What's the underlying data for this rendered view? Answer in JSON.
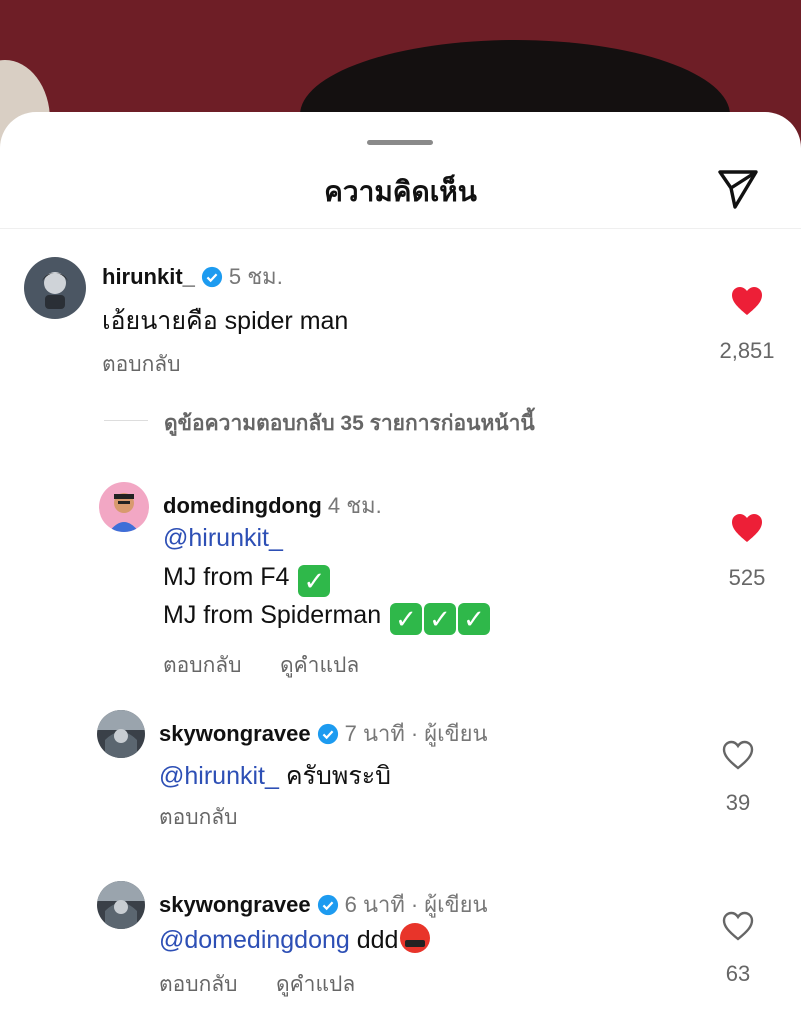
{
  "sheet": {
    "title": "ความคิดเห็น"
  },
  "colors": {
    "mention": "#2d4fb5",
    "heart_filled": "#ed1f37",
    "verified": "#1d9bf0",
    "photo_bg": "#6e1e26"
  },
  "comments": [
    {
      "username": "hirunkit_",
      "verified": true,
      "time": "5 ชม.",
      "text": "เอ้ยนายคือ spider man",
      "reply_label": "ตอบกลับ",
      "likes": "2,851",
      "liked": true,
      "view_replies": "ดูข้อความตอบกลับ 35 รายการก่อนหน้านี้"
    },
    {
      "username": "domedingdong",
      "verified": false,
      "time": "4 ชม.",
      "mention": "@hirunkit_",
      "line1": "MJ from F4",
      "line2": "MJ from Spiderman",
      "reply_label": "ตอบกลับ",
      "translate_label": "ดูคำแปล",
      "likes": "525",
      "liked": true
    },
    {
      "username": "skywongravee",
      "verified": true,
      "time": "7 นาที",
      "author_tag": "ผู้เขียน",
      "mention": "@hirunkit_",
      "text": "ครับพระบิ",
      "reply_label": "ตอบกลับ",
      "likes": "39",
      "liked": false
    },
    {
      "username": "skywongravee",
      "verified": true,
      "time": "6 นาที",
      "author_tag": "ผู้เขียน",
      "mention": "@domedingdong",
      "text": "ddd",
      "reply_label": "ตอบกลับ",
      "translate_label": "ดูคำแปล",
      "likes": "63",
      "liked": false
    }
  ],
  "separator": "·"
}
